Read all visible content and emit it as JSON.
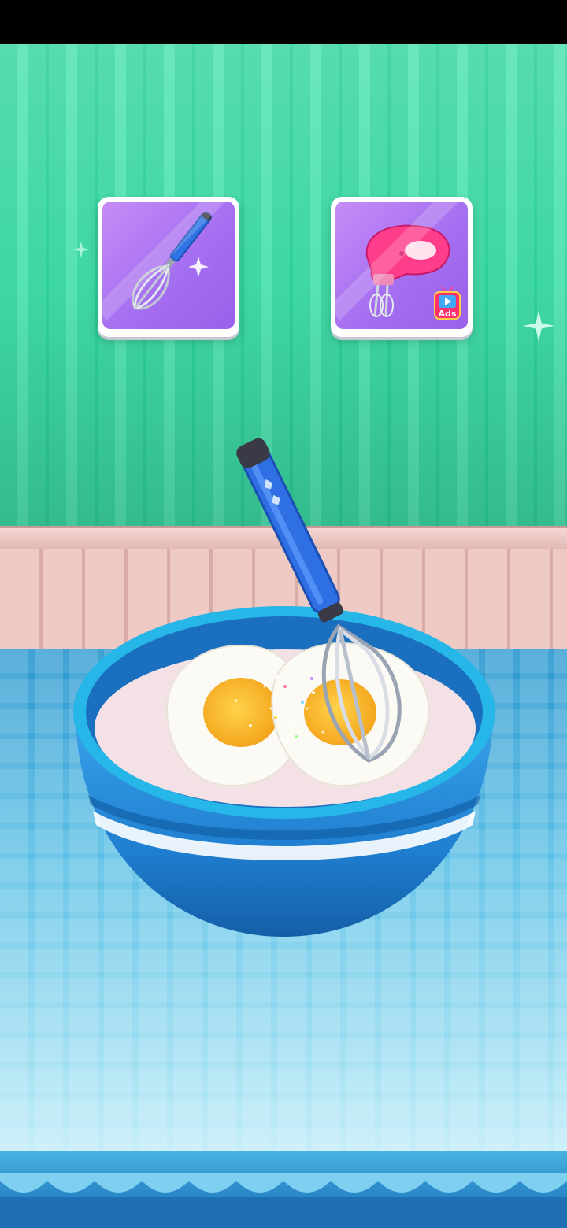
{
  "screen": "whisking-eggs",
  "tools": [
    {
      "id": "whisk",
      "icon": "whisk-icon"
    },
    {
      "id": "electric-mixer",
      "icon": "electric-mixer-icon",
      "badge": "Ads"
    }
  ],
  "bowl": {
    "contents": [
      "flour",
      "egg",
      "egg",
      "sugar-sprinkles"
    ]
  },
  "colors": {
    "wall": "#3fd7a4",
    "card": "#a56ff1",
    "bowl": "#1f7fd0",
    "counter": "#5bc0e6",
    "mixer": "#ff3d8b"
  }
}
